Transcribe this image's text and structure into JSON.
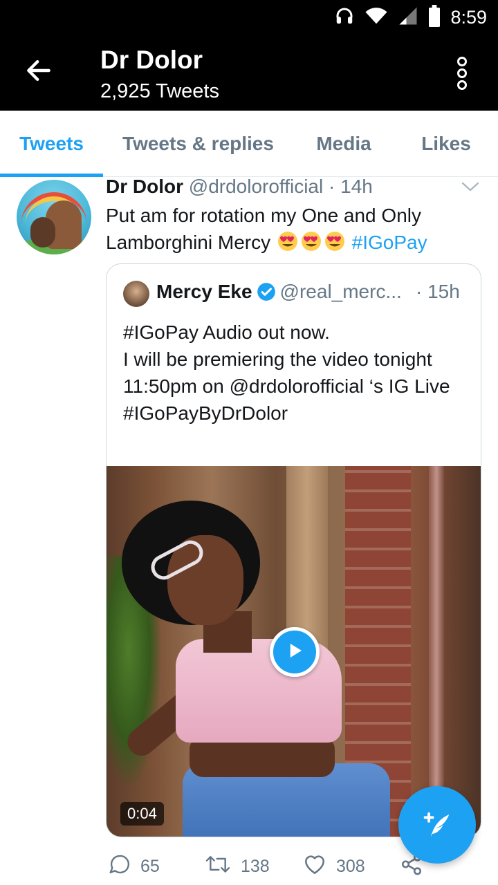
{
  "status_bar": {
    "time": "8:59",
    "icons": [
      "headphones-icon",
      "wifi-icon",
      "signal-icon",
      "battery-icon"
    ]
  },
  "header": {
    "title": "Dr Dolor",
    "subtitle": "2,925 Tweets",
    "back_icon": "arrow-left-icon",
    "more_icon": "more-vertical-icon"
  },
  "tabs": [
    {
      "label": "Tweets",
      "active": true
    },
    {
      "label": "Tweets & replies",
      "active": false
    },
    {
      "label": "Media",
      "active": false
    },
    {
      "label": "Likes",
      "active": false
    }
  ],
  "tweet": {
    "name": "Dr Dolor",
    "handle": "@drdolorofficial",
    "separator": " · ",
    "time": "14h",
    "text_line1": "Put am for rotation my One and Only",
    "text_line2": "Lamborghini Mercy ",
    "emoji": "heart-eyes-emoji",
    "hashtag": "#IGoPay",
    "quote": {
      "name": "Mercy Eke",
      "handle": "@real_merc...",
      "time": "· 15h",
      "text": "#IGoPay Audio out now.\nI will be premiering the video tonight 11:50pm on @drdolorofficial ‘s  IG Live\n#IGoPayByDrDolor",
      "video_duration": "0:04"
    },
    "actions": {
      "replies": "65",
      "retweets": "138",
      "likes": "308"
    }
  },
  "colors": {
    "accent": "#1da1f2",
    "header_bg": "#000000",
    "muted": "#657786",
    "border": "#ccd6dd"
  }
}
